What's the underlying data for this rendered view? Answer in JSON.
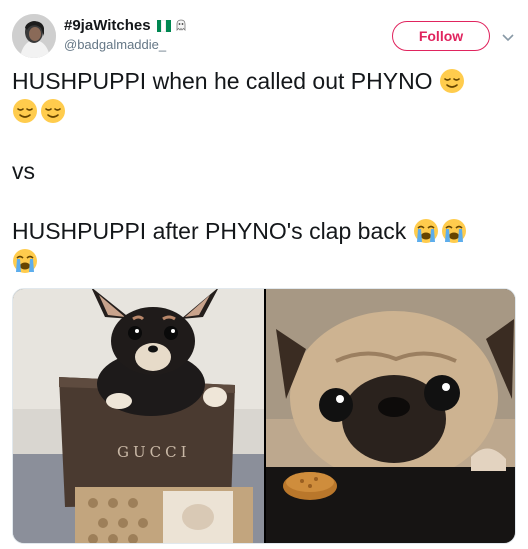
{
  "user": {
    "display_name": "#9jaWitches",
    "handle": "@badgalmaddie_"
  },
  "follow_button": {
    "label": "Follow"
  },
  "tweet": {
    "line1": "HUSHPUPPI when he called out PHYNO",
    "line2": "vs",
    "line3": "HUSHPUPPI after PHYNO's clap back"
  },
  "media": {
    "left_photo": {
      "box_text": "GUCCI"
    }
  },
  "colors": {
    "follow_accent": "#e0245e",
    "handle_gray": "#657786",
    "text": "#14171a",
    "flag_green": "#008751"
  },
  "icons": [
    "avatar",
    "nigeria-flag-icon",
    "ghost-icon",
    "chevron-down-icon",
    "relieved-face-emoji",
    "crying-face-emoji"
  ]
}
